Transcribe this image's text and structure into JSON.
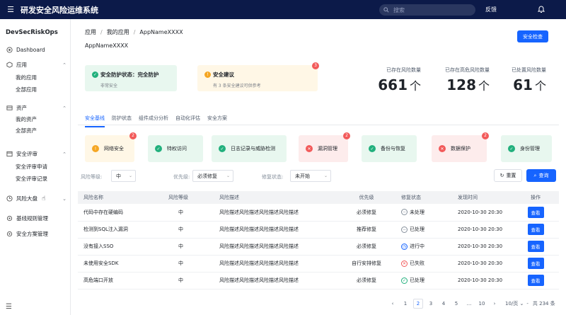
{
  "header": {
    "menu_icon": "menu-icon",
    "title": "研发安全风险运维系统",
    "search_placeholder": "搜索",
    "feedback": "反馈",
    "bell_icon": "bell-icon"
  },
  "sidebar": {
    "brand": "DevSecRiskOps",
    "items": [
      {
        "label": "Dashboard",
        "icon": "dashboard-icon"
      },
      {
        "label": "应用",
        "icon": "app-icon",
        "children": [
          "我的应用",
          "全部应用"
        ]
      },
      {
        "label": "资产",
        "icon": "asset-icon",
        "children": [
          "我的资产",
          "全部资产"
        ]
      },
      {
        "label": "安全评审",
        "icon": "review-icon",
        "children": [
          "安全评审申请",
          "安全评审记录"
        ]
      },
      {
        "label": "风险大盘",
        "icon": "risk-icon"
      },
      {
        "label": "基线规则管理",
        "icon": "baseline-icon"
      },
      {
        "label": "安全方案管理",
        "icon": "plan-icon"
      }
    ]
  },
  "breadcrumb": {
    "level1": "应用",
    "level2": "我的应用",
    "level3": "AppNameXXXX"
  },
  "page_title": "AppNameXXXX",
  "security_check_btn": "安全检查",
  "status_card": {
    "title": "安全防护状态：完全防护",
    "subtitle": "非常安全"
  },
  "advice_card": {
    "title": "安全建议",
    "subtitle": "有 3 条安全建议可供参考",
    "badge": "3"
  },
  "stats": [
    {
      "label": "已存在风险数量",
      "value": "661",
      "unit": "个"
    },
    {
      "label": "已存在高危风险数量",
      "value": "128",
      "unit": "个"
    },
    {
      "label": "已处置风险数量",
      "value": "61",
      "unit": "个"
    }
  ],
  "tabs": [
    "安全基线",
    "防护状态",
    "组件成分分析",
    "自动化评估",
    "安全方案"
  ],
  "categories": [
    {
      "label": "网络安全",
      "status": "warning",
      "badge": "2"
    },
    {
      "label": "特权访问",
      "status": "ok",
      "badge": ""
    },
    {
      "label": "日志记录与威胁检测",
      "status": "ok",
      "badge": ""
    },
    {
      "label": "漏洞管理",
      "status": "error",
      "badge": "2"
    },
    {
      "label": "备份与恢复",
      "status": "ok",
      "badge": ""
    },
    {
      "label": "数据保护",
      "status": "error",
      "badge": "2"
    },
    {
      "label": "身份管理",
      "status": "ok",
      "badge": ""
    }
  ],
  "filters": {
    "risk_level_label": "风险等级:",
    "risk_level_value": "中",
    "priority_label": "优先级:",
    "priority_value": "必须修复",
    "fix_status_label": "修复状态:",
    "fix_status_value": "未开始",
    "reset": "重置",
    "query": "查询"
  },
  "table": {
    "headers": [
      "风险名称",
      "风险等级",
      "风险描述",
      "优先级",
      "修复状态",
      "发现时间",
      "操作"
    ],
    "rows": [
      [
        "代码中存在硬编码",
        "中",
        "风险描述风险描述风险描述风险描述",
        "必须修复",
        "未处理",
        "2020-10-30 20:30",
        "查看"
      ],
      [
        "检测到SQL注入漏洞",
        "中",
        "风险描述风险描述风险描述风险描述",
        "推荐修复",
        "已处理",
        "2020-10-30 20:30",
        "查看"
      ],
      [
        "没有接入SSO",
        "中",
        "风险描述风险描述风险描述风险描述",
        "必须修复",
        "进行中",
        "2020-10-30 20:30",
        "查看"
      ],
      [
        "未使用安全SDK",
        "中",
        "风险描述风险描述风险描述风险描述",
        "自行安排修复",
        "已失败",
        "2020-10-30 20:30",
        "查看"
      ],
      [
        "高危端口开放",
        "中",
        "风险描述风险描述风险描述风险描述",
        "必须修复",
        "已处理",
        "2020-10-30 20:30",
        "查看"
      ]
    ],
    "status_icons": [
      "minus-circle-icon",
      "minus-circle-icon",
      "clock-icon",
      "x-circle-icon",
      "check-circle-icon"
    ],
    "status_colors": [
      "#86909c",
      "#86909c",
      "#1664ff",
      "#f25a5a",
      "#22b07d"
    ]
  },
  "pager": {
    "prev": "‹",
    "pages": [
      "1",
      "2",
      "3",
      "4",
      "5",
      "...",
      "10"
    ],
    "current": "2",
    "next": "›",
    "page_size": "10/页",
    "goto_sep": "-",
    "total": "共 234 条"
  },
  "colors": {
    "primary": "#1664ff",
    "nav_bg": "#0c1a49",
    "ok": "#22b07d",
    "warn": "#f5a623",
    "error": "#f25a5a"
  }
}
